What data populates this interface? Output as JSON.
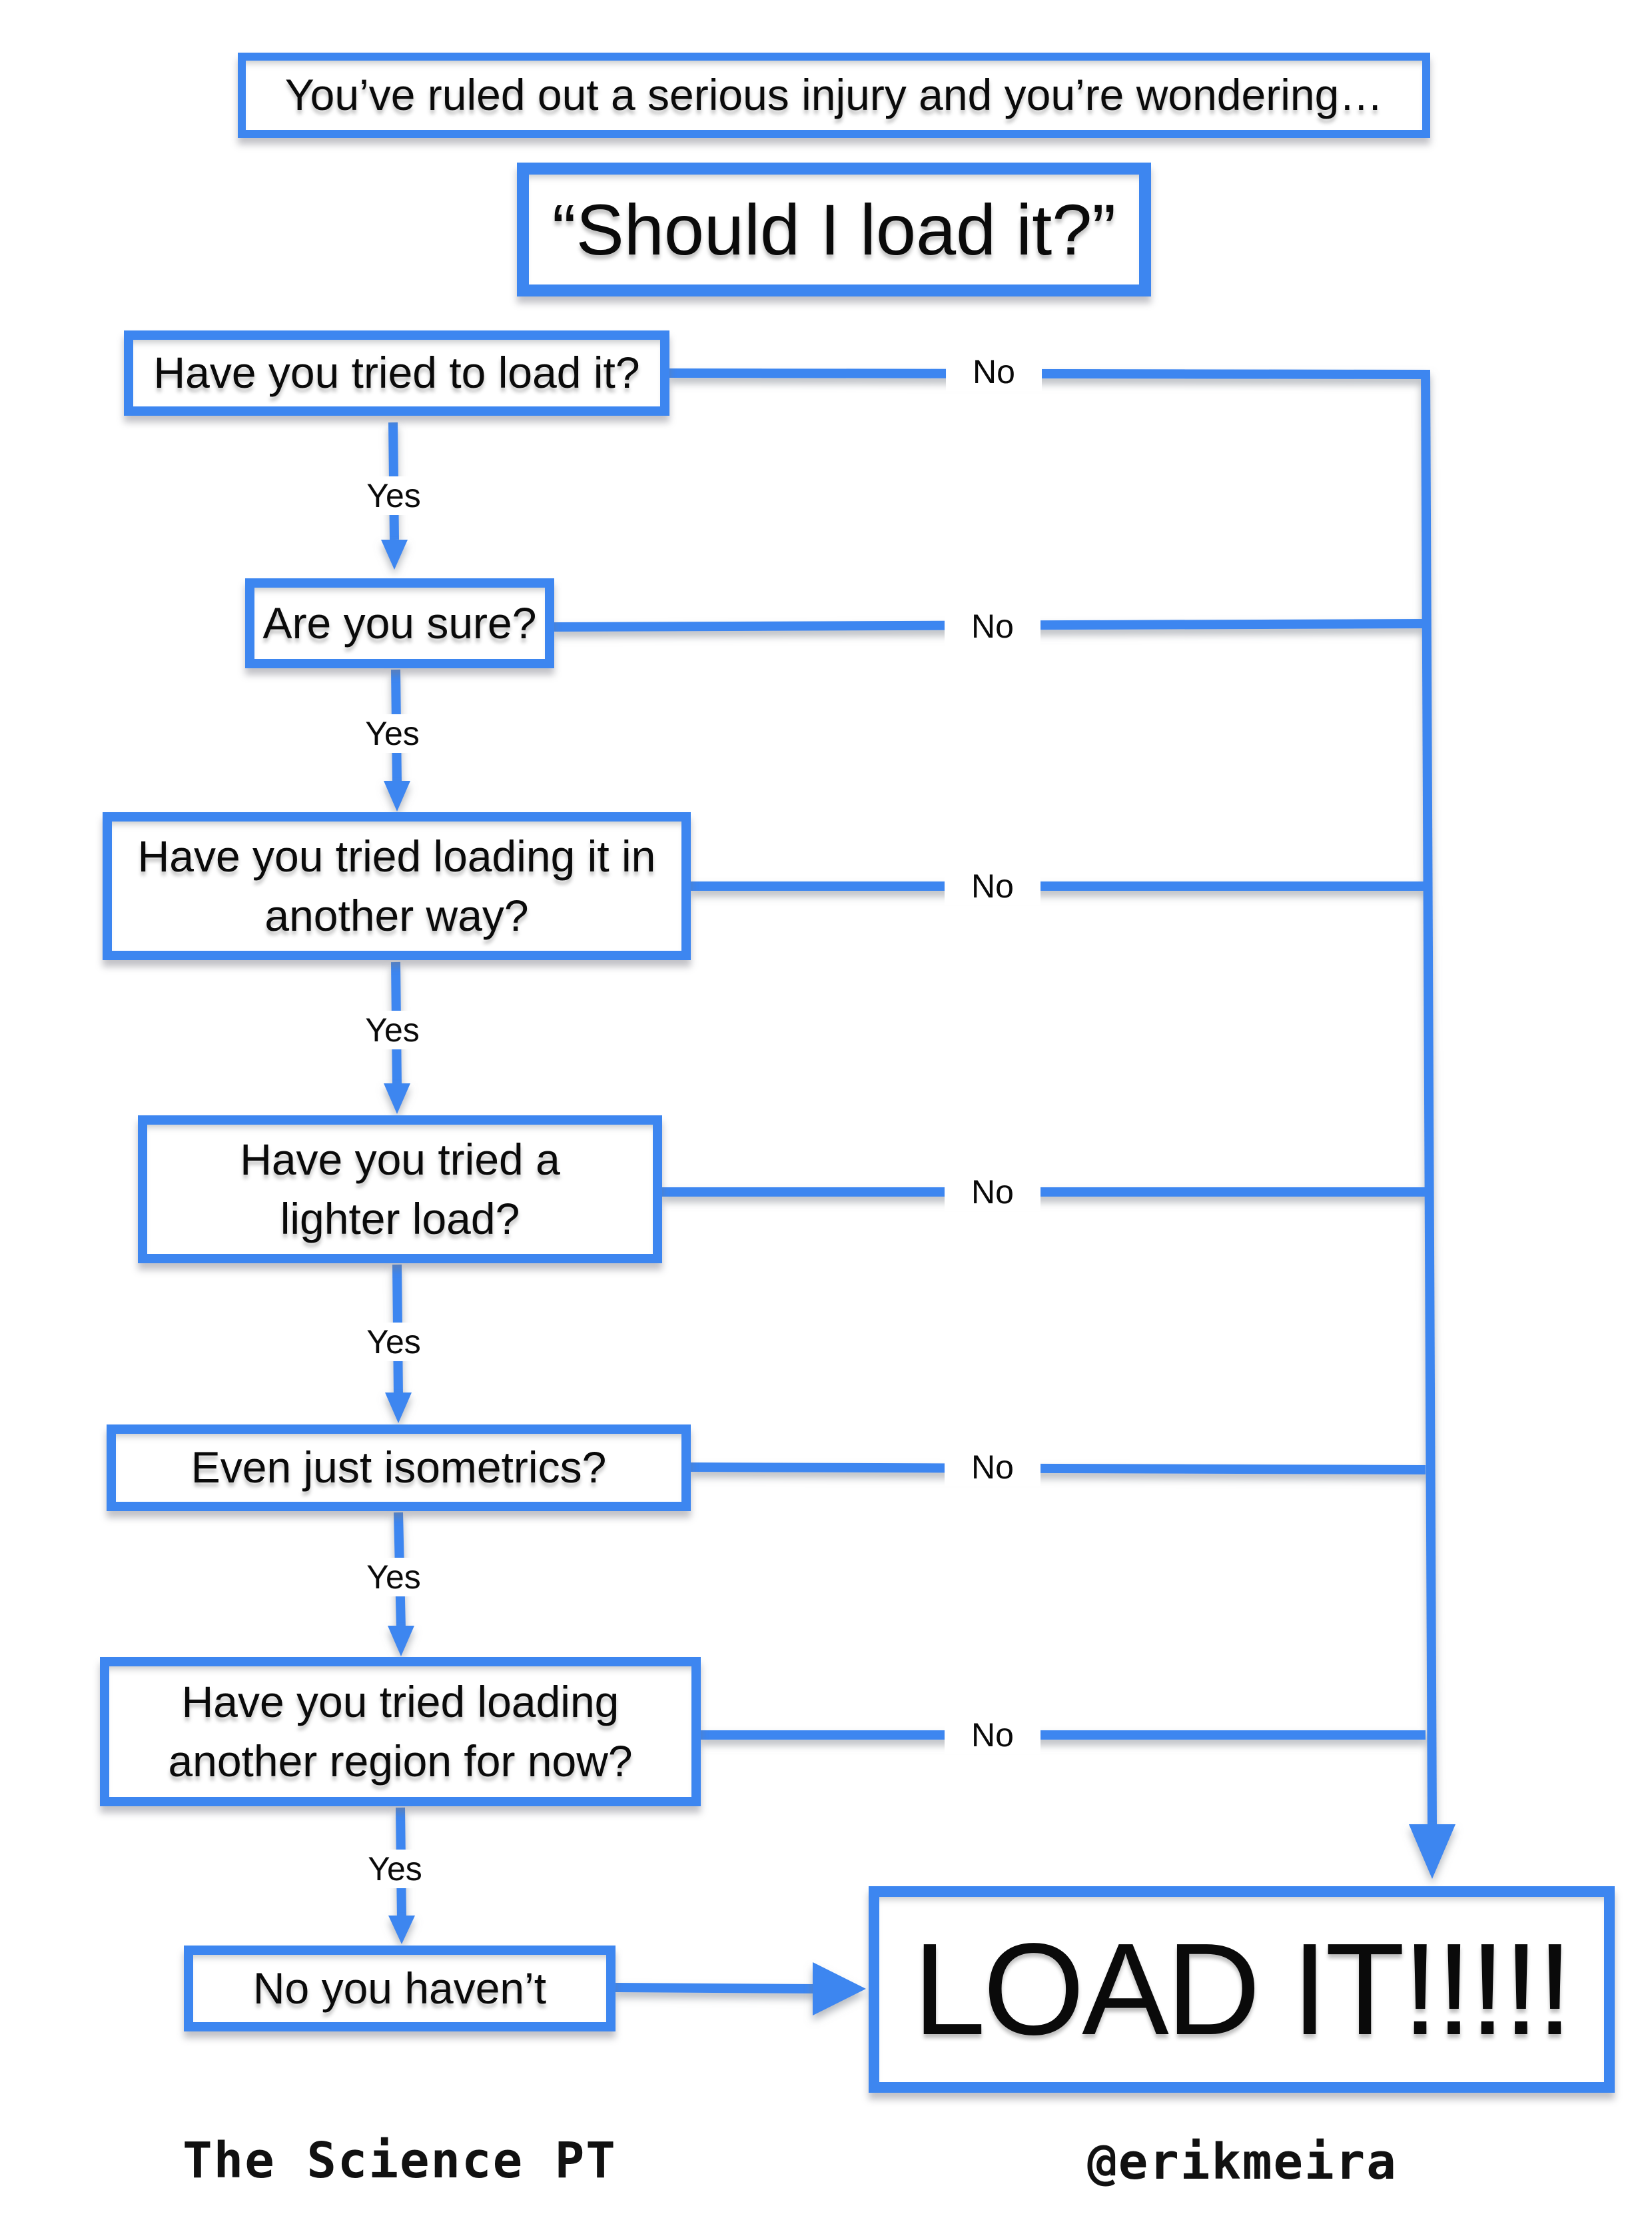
{
  "header": {
    "intro": "You’ve ruled out a serious injury and you’re wondering…",
    "title": "“Should I load it?”"
  },
  "questions": [
    {
      "text": "Have you tried to load it?",
      "yes_label": "Yes",
      "no_label": "No"
    },
    {
      "text": "Are you sure?",
      "yes_label": "Yes",
      "no_label": "No"
    },
    {
      "text": "Have you tried loading it in another way?",
      "yes_label": "Yes",
      "no_label": "No"
    },
    {
      "text": "Have you tried a lighter load?",
      "yes_label": "Yes",
      "no_label": "No"
    },
    {
      "text": "Even just isometrics?",
      "yes_label": "Yes",
      "no_label": "No"
    },
    {
      "text": "Have you tried loading another region for now?",
      "yes_label": "Yes",
      "no_label": "No"
    }
  ],
  "final_step": "No you haven’t",
  "outcome": "LOAD IT!!!!!",
  "footer": {
    "left": "The Science PT",
    "right": "@erikmeira"
  },
  "colors": {
    "accent": "#3d86f0",
    "text": "#0a0a0a",
    "background": "#ffffff"
  }
}
